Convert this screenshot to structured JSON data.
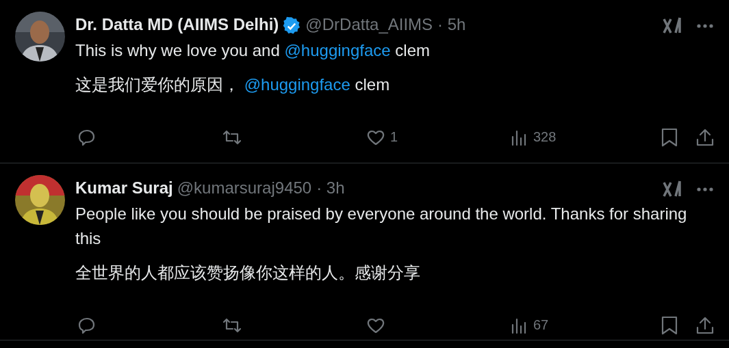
{
  "tweets": [
    {
      "name": "Dr. Datta MD (AIIMS Delhi)",
      "verified": true,
      "handle": "@DrDatta_AIIMS",
      "time": "· 5h",
      "text": [
        {
          "kind": "plain",
          "text": "This is why we love you and "
        },
        {
          "kind": "mention",
          "text": "@huggingface"
        },
        {
          "kind": "plain",
          "text": " clem"
        }
      ],
      "translation": [
        {
          "kind": "plain",
          "text": "这是我们爱你的原因， "
        },
        {
          "kind": "mention",
          "text": "@huggingface"
        },
        {
          "kind": "plain",
          "text": " clem"
        }
      ],
      "likes": "1",
      "views": "328"
    },
    {
      "name": "Kumar Suraj",
      "verified": false,
      "handle": "@kumarsuraj9450",
      "time": "· 3h",
      "text": [
        {
          "kind": "plain",
          "text": "People like you should be praised by everyone around the world. Thanks for sharing this"
        }
      ],
      "translation": [
        {
          "kind": "plain",
          "text": "全世界的人都应该赞扬像你这样的人。感谢分享"
        }
      ],
      "views": "67"
    }
  ]
}
